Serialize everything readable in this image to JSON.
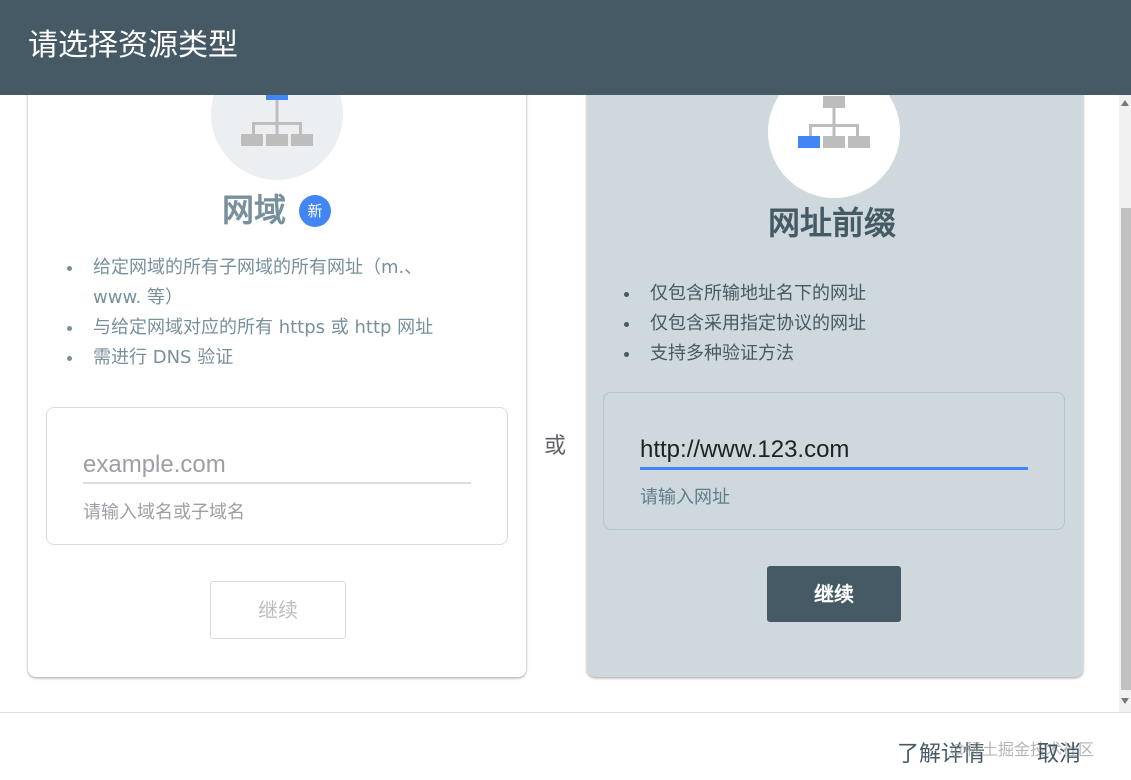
{
  "dialog": {
    "title": "请选择资源类型"
  },
  "domain_card": {
    "title": "网域",
    "badge": "新",
    "bullets": [
      "给定网域的所有子网域的所有网址（m.、www. 等）",
      "与给定网域对应的所有 https 或 http 网址",
      "需进行 DNS 验证"
    ],
    "input_placeholder": "example.com",
    "input_hint": "请输入域名或子域名",
    "continue_label": "继续",
    "icon": "domain-tree-icon",
    "continue_enabled": false
  },
  "or_label": "或",
  "prefix_card": {
    "title": "网址前缀",
    "bullets": [
      "仅包含所输地址名下的网址",
      "仅包含采用指定协议的网址",
      "支持多种验证方法"
    ],
    "input_value": "http://www.123.com",
    "input_hint": "请输入网址",
    "continue_label": "继续",
    "icon": "url-prefix-tree-icon",
    "continue_enabled": true
  },
  "footer": {
    "learn_more_label": "了解详情",
    "cancel_label": "取消",
    "watermark": "@稀土掘金技术社区"
  },
  "colors": {
    "header_bg": "#455a64",
    "accent_blue": "#4285f4",
    "selected_card_bg": "#cfd8dc"
  }
}
